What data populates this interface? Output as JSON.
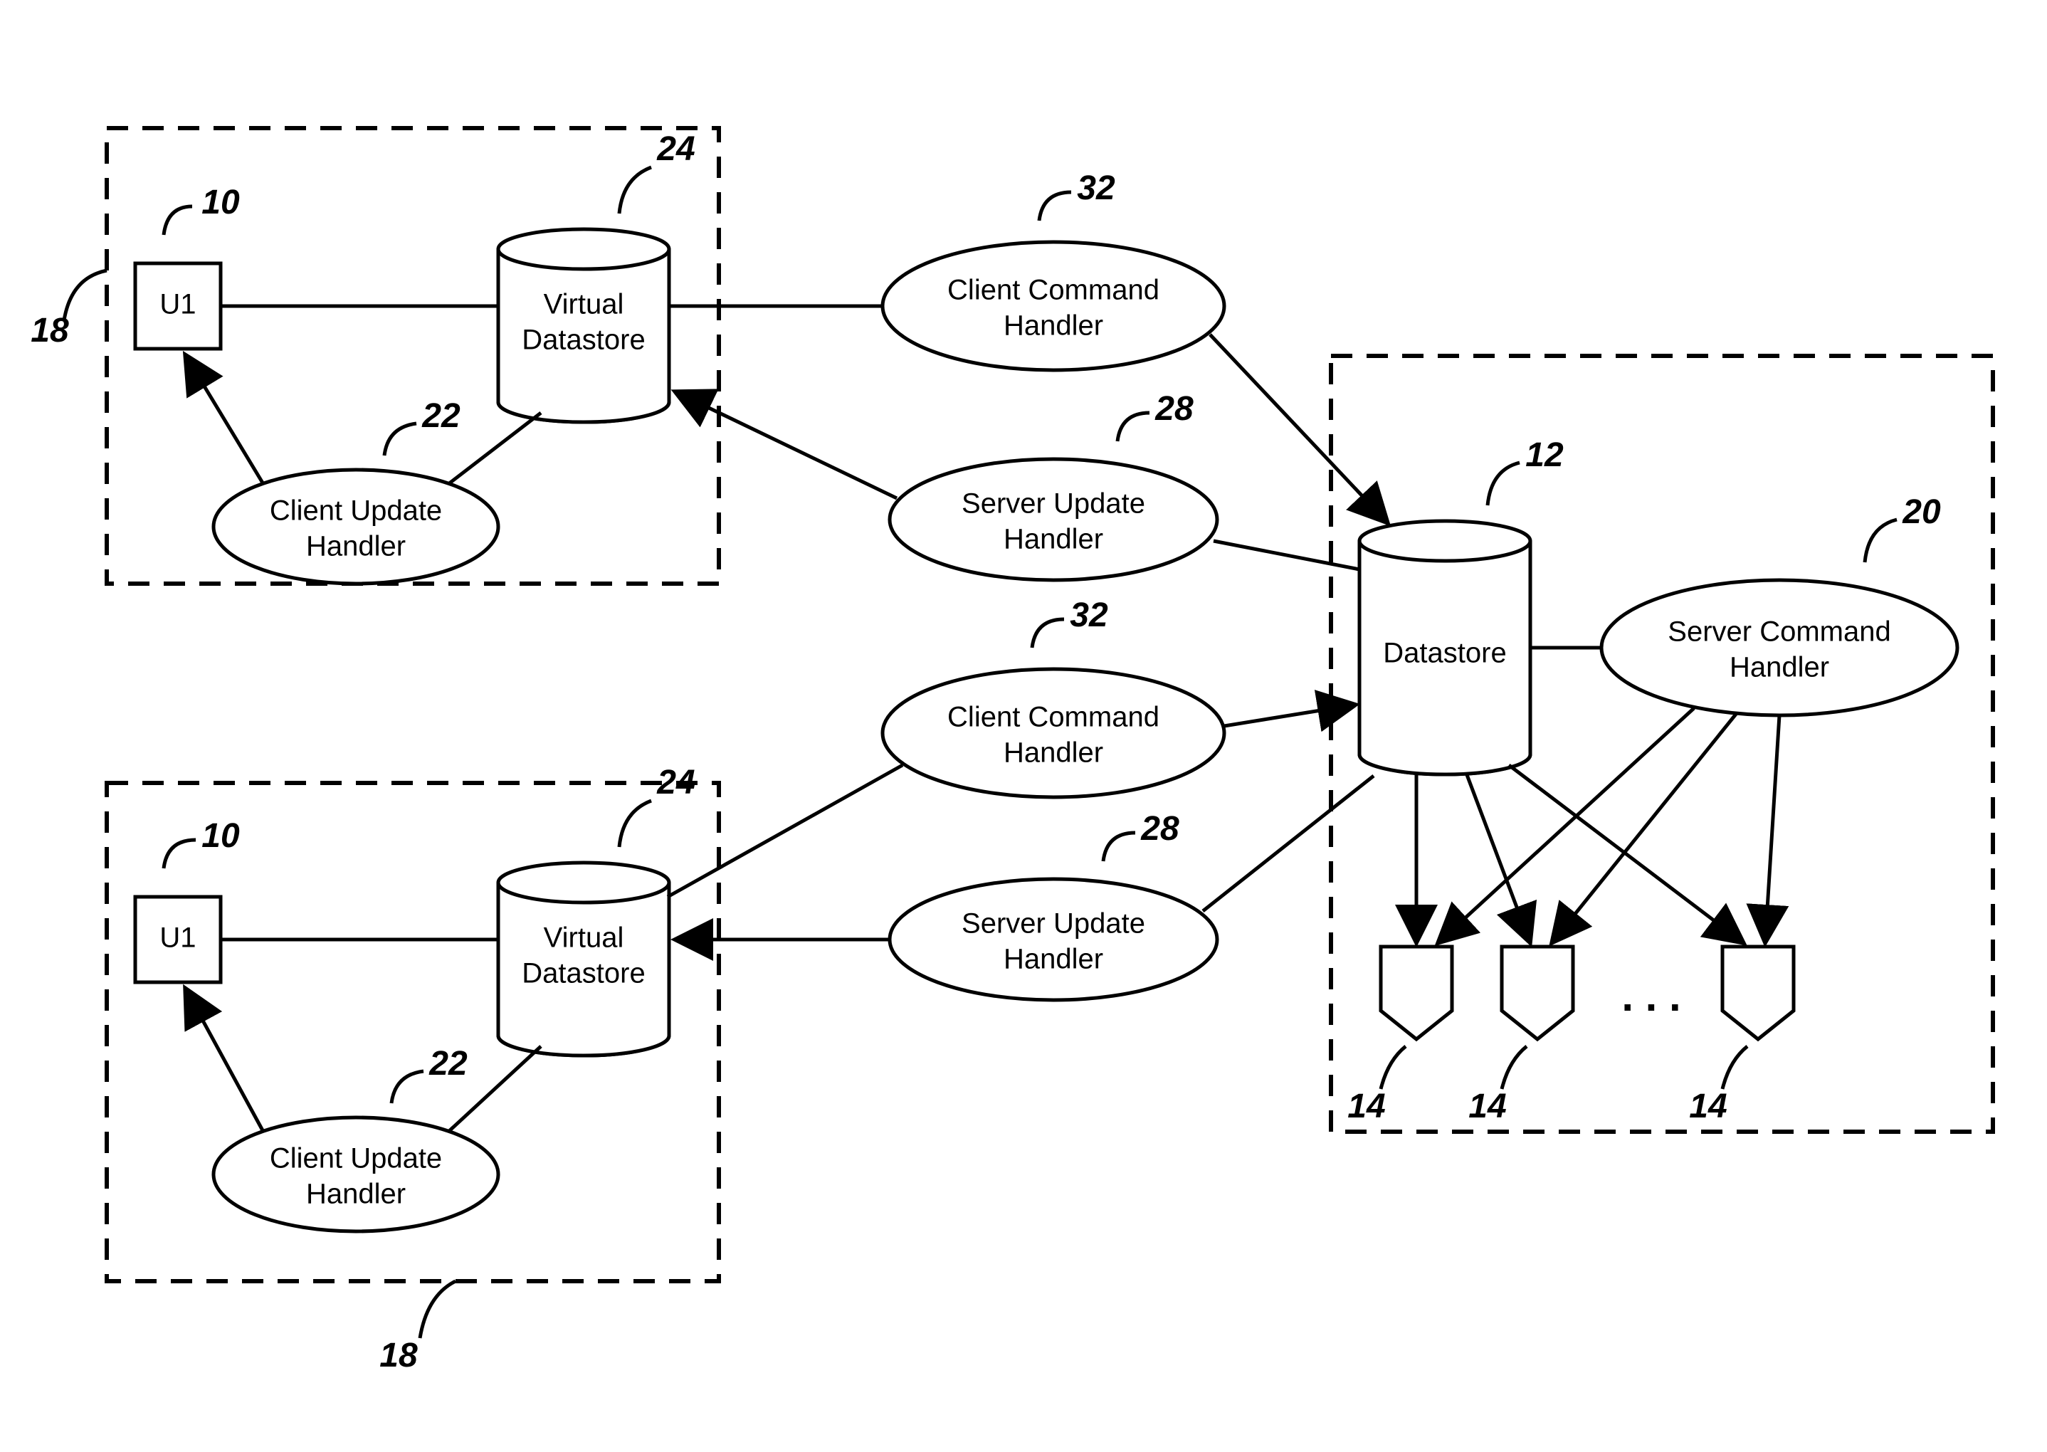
{
  "clientA": {
    "ref": "18",
    "u1": {
      "label": "U1",
      "ref": "10"
    },
    "virtualDatastore": {
      "line1": "Virtual",
      "line2": "Datastore",
      "ref": "24"
    },
    "clientUpdateHandler": {
      "line1": "Client Update",
      "line2": "Handler",
      "ref": "22"
    }
  },
  "clientB": {
    "ref": "18",
    "u1": {
      "label": "U1",
      "ref": "10"
    },
    "virtualDatastore": {
      "line1": "Virtual",
      "line2": "Datastore",
      "ref": "24"
    },
    "clientUpdateHandler": {
      "line1": "Client Update",
      "line2": "Handler",
      "ref": "22"
    }
  },
  "middle": {
    "clientCommandHandlerA": {
      "line1": "Client Command",
      "line2": "Handler",
      "ref": "32"
    },
    "serverUpdateHandlerA": {
      "line1": "Server Update",
      "line2": "Handler",
      "ref": "28"
    },
    "clientCommandHandlerB": {
      "line1": "Client Command",
      "line2": "Handler",
      "ref": "32"
    },
    "serverUpdateHandlerB": {
      "line1": "Server Update",
      "line2": "Handler",
      "ref": "28"
    }
  },
  "server": {
    "datastore": {
      "label": "Datastore",
      "ref": "12"
    },
    "serverCommandHandler": {
      "line1": "Server Command",
      "line2": "Handler",
      "ref": "20"
    },
    "outputs": {
      "ref1": "14",
      "ref2": "14",
      "ref3": "14",
      "ellipsis": ". . ."
    }
  }
}
